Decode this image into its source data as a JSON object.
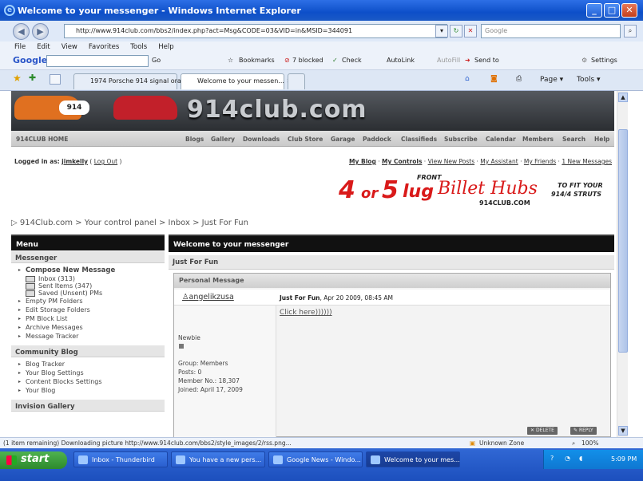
{
  "window": {
    "title": "Welcome to your messenger - Windows Internet Explorer"
  },
  "address": {
    "url": "http://www.914club.com/bbs2/index.php?act=Msg&CODE=03&VID=in&MSID=344091",
    "search_placeholder": "Google"
  },
  "menu": [
    "File",
    "Edit",
    "View",
    "Favorites",
    "Tools",
    "Help"
  ],
  "googlebar": {
    "go": "Go",
    "bookmarks": "Bookmarks",
    "blocked": "7 blocked",
    "check": "Check",
    "autolink": "AutoLink",
    "autofill": "AutoFill",
    "sendto": "Send to",
    "settings": "Settings"
  },
  "tabs": [
    {
      "label": "1974 Porsche 914 signal ora..."
    },
    {
      "label": "Welcome to your messen..."
    }
  ],
  "tabtools": {
    "page": "Page",
    "tools": "Tools"
  },
  "site": {
    "logo": "914club.com",
    "nav_home": "914CLUB HOME",
    "nav": [
      "Blogs",
      "Gallery",
      "Downloads",
      "Club Store",
      "Garage",
      "Paddock",
      "Classifieds",
      "Subscribe",
      "Calendar",
      "Members",
      "Search",
      "Help"
    ],
    "logged_prefix": "Logged in as:",
    "user": "jimkelly",
    "logout": "Log Out",
    "toplinks": [
      "My Blog",
      "My Controls",
      "View New Posts",
      "My Assistant",
      "My Friends",
      "1 New Messages"
    ],
    "ad": {
      "num1": "4",
      "or": "or",
      "num2": "5",
      "lug": "lug",
      "front": "FRONT",
      "brand": "Billet Hubs",
      "site": "914CLUB.COM",
      "fit1": "TO FIT YOUR",
      "fit2": "914/4 STRUTS"
    },
    "breadcrumb": "914Club.com > Your control panel > Inbox > Just For Fun"
  },
  "sidebar": {
    "header": "Menu",
    "messenger_title": "Messenger",
    "compose": "Compose New Message",
    "folders": [
      "Inbox (313)",
      "Sent Items (347)",
      "Saved (Unsent) PMs"
    ],
    "messenger_items": [
      "Empty PM Folders",
      "Edit Storage Folders",
      "PM Block List",
      "Archive Messages",
      "Message Tracker"
    ],
    "blog_title": "Community Blog",
    "blog_items": [
      "Blog Tracker",
      "Your Blog Settings",
      "Content Blocks Settings",
      "Your Blog"
    ],
    "gallery_title": "Invision Gallery"
  },
  "main": {
    "header": "Welcome to your messenger",
    "subheader": "Just For Fun",
    "pm_header": "Personal Message",
    "author": "angelikzusa",
    "subject": "Just For Fun",
    "date": ", Apr 20 2009, 08:45 AM",
    "body": "Click here))))))",
    "rank": "Newbie",
    "group": "Group: Members",
    "posts": "Posts: 0",
    "member_no": "Member No.: 18,307",
    "joined": "Joined: April 17, 2009",
    "delete": "DELETE",
    "reply": "REPLY"
  },
  "status": {
    "text": "(1 item remaining) Downloading picture http://www.914club.com/bbs2/style_images/2/rss.png...",
    "zone": "Unknown Zone",
    "zoom": "100%"
  },
  "taskbar": {
    "start": "start",
    "tasks": [
      "Inbox - Thunderbird",
      "You have a new pers...",
      "Google News - Windo...",
      "Welcome to your mes..."
    ],
    "clock": "5:09 PM"
  }
}
